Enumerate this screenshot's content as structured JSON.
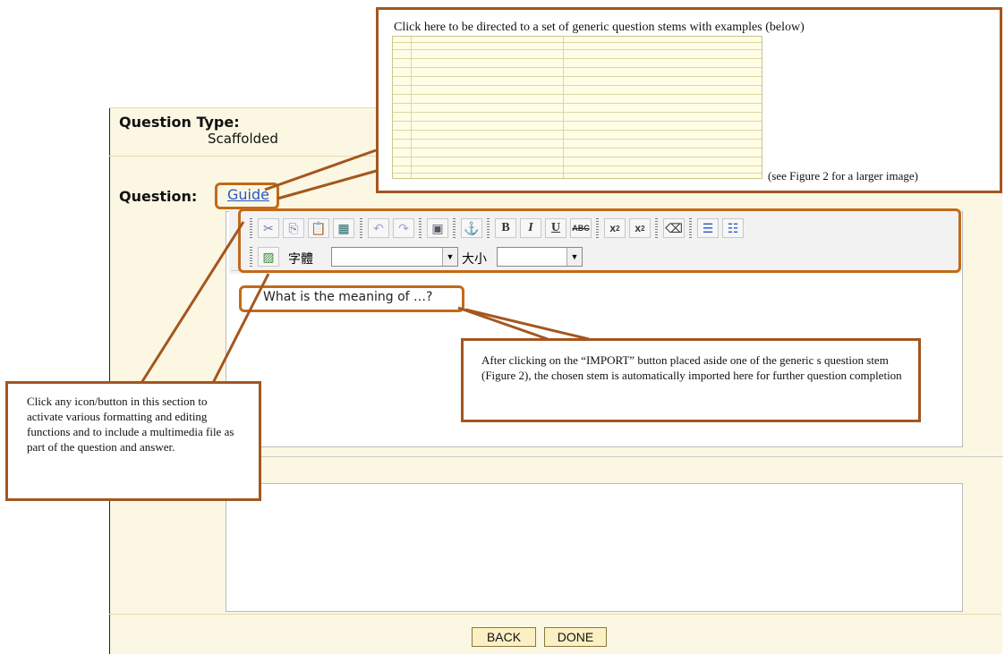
{
  "form": {
    "question_type_label": "Question Type:",
    "question_type_value": "Scaffolded",
    "question_label": "Question:",
    "guide_link": "Guide",
    "editor_text": "What is the meaning of …?",
    "font_label": "字體",
    "size_label": "大小",
    "font_value": "",
    "size_value": "",
    "back_button": "BACK",
    "done_button": "DONE"
  },
  "toolbar_icons": [
    "cut-icon",
    "copy-icon",
    "paste-icon",
    "select-all-icon",
    "undo-icon",
    "redo-icon",
    "insert-object-icon",
    "anchor-icon",
    "bold-icon",
    "italic-icon",
    "underline-icon",
    "strikethrough-icon",
    "subscript-icon",
    "superscript-icon",
    "eraser-icon",
    "ordered-list-icon",
    "unordered-list-icon",
    "image-icon"
  ],
  "callouts": {
    "top": "Click here to be directed to a set of generic question stems with examples (below)",
    "top_note": "(see Figure 2 for a larger image)",
    "left": "Click any icon/button in this section to activate various formatting and editing functions and to include a multimedia file as part of the question and answer.",
    "right": "After clicking on the “IMPORT” button placed aside one of the generic s question stem (Figure 2), the chosen stem is automatically imported here for further question completion"
  },
  "colors": {
    "callout_border": "#a4561f",
    "highlight_border": "#c26a1a",
    "form_bg": "#fbf7e2",
    "link": "#2a56c6"
  }
}
